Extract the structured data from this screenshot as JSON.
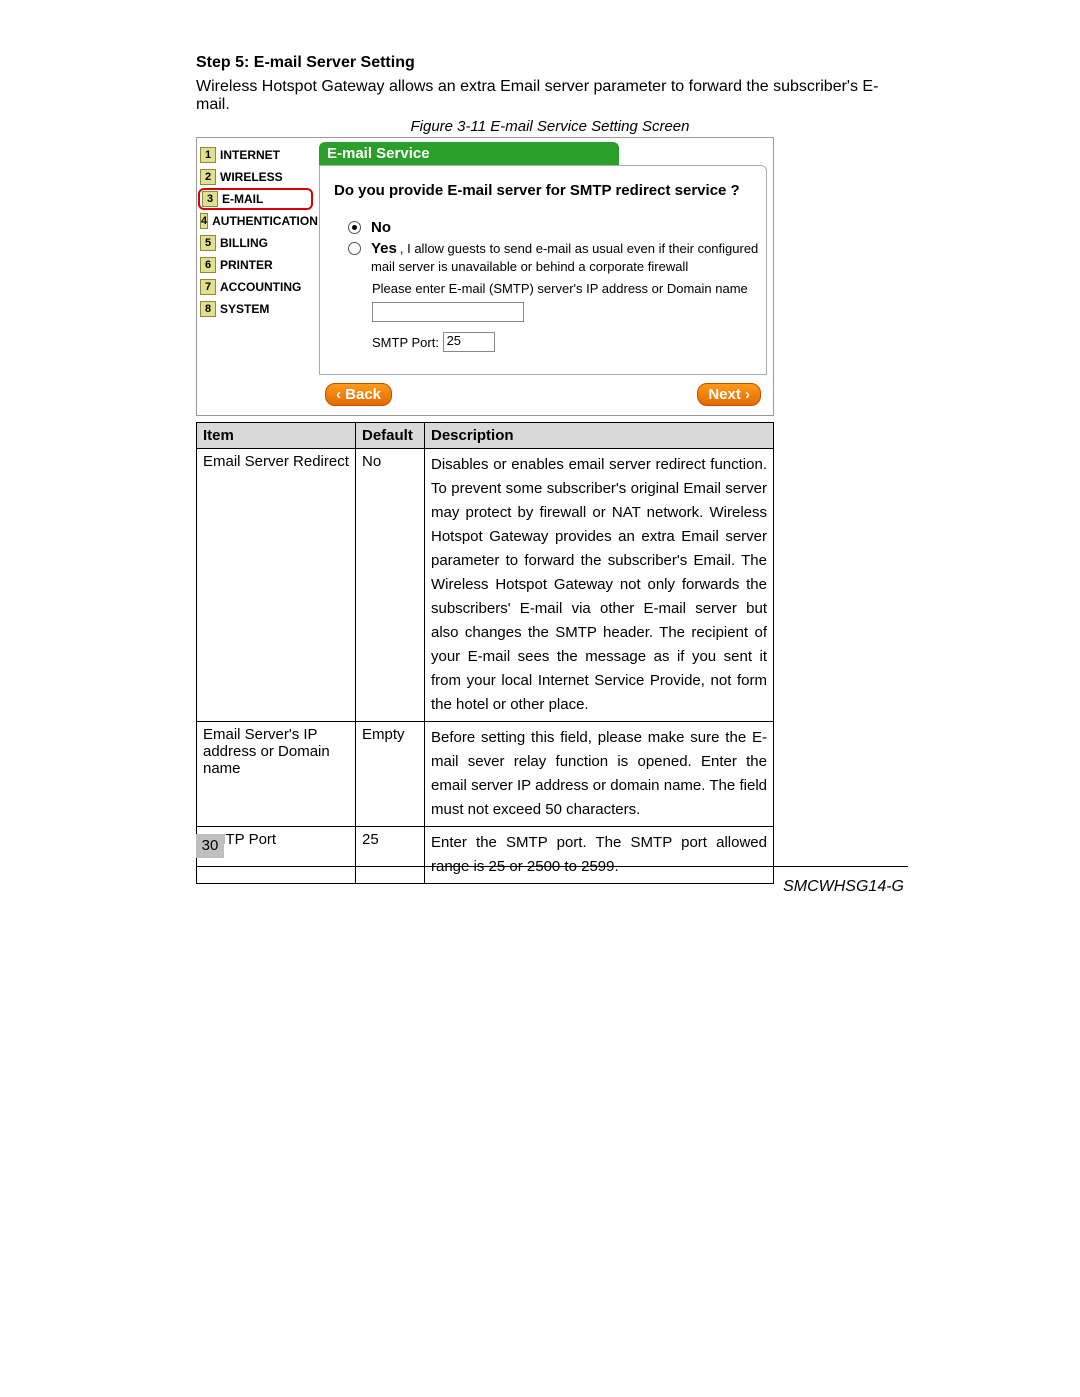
{
  "step_title": "Step 5: E-mail Server Setting",
  "intro": "Wireless Hotspot Gateway allows an extra Email server parameter to forward the subscriber's E-mail.",
  "figure_caption": "Figure 3-11 E-mail Service Setting Screen",
  "nav": [
    {
      "num": "1",
      "label": "INTERNET"
    },
    {
      "num": "2",
      "label": "WIRELESS"
    },
    {
      "num": "3",
      "label": "E-MAIL",
      "selected": true
    },
    {
      "num": "4",
      "label": "AUTHENTICATION"
    },
    {
      "num": "5",
      "label": "BILLING"
    },
    {
      "num": "6",
      "label": "PRINTER"
    },
    {
      "num": "7",
      "label": "ACCOUNTING"
    },
    {
      "num": "8",
      "label": "SYSTEM"
    }
  ],
  "panel": {
    "title": "E-mail Service",
    "question": "Do you provide E-mail server for SMTP redirect service ?",
    "no_label": "No",
    "yes_label": "Yes",
    "yes_text": ", I allow guests to send e-mail as usual even if their configured mail server is unavailable or behind a corporate firewall",
    "enter_label": "Please enter E-mail (SMTP) server's IP address or Domain name",
    "smtp_label": "SMTP Port:",
    "smtp_value": "25",
    "back_btn": "‹ Back",
    "next_btn": "Next ›"
  },
  "table": {
    "headers": {
      "item": "Item",
      "def": "Default",
      "desc": "Description"
    },
    "rows": [
      {
        "item": "Email Server Redirect",
        "def": "No",
        "desc": "Disables or enables email server redirect function. To prevent some subscriber's original Email server may protect by firewall or NAT network. Wireless Hotspot Gateway provides an extra Email server parameter to forward the subscriber's Email. The Wireless Hotspot Gateway not only forwards the subscribers' E-mail via other E-mail server but also changes the SMTP header. The recipient of your E-mail sees the message as if you sent it from your local Internet Service Provide, not form the hotel or other place."
      },
      {
        "item": "Email Server's IP address or Domain name",
        "def": "Empty",
        "desc": "Before setting this field, please make sure the E-mail sever relay function is opened. Enter the email server IP address or domain name. The field must not exceed 50 characters."
      },
      {
        "item": "SMTP Port",
        "def": "25",
        "desc": "Enter the SMTP port. The SMTP port allowed range is 25 or 2500 to 2599."
      }
    ]
  },
  "page_num": "30",
  "model": "SMCWHSG14-G"
}
